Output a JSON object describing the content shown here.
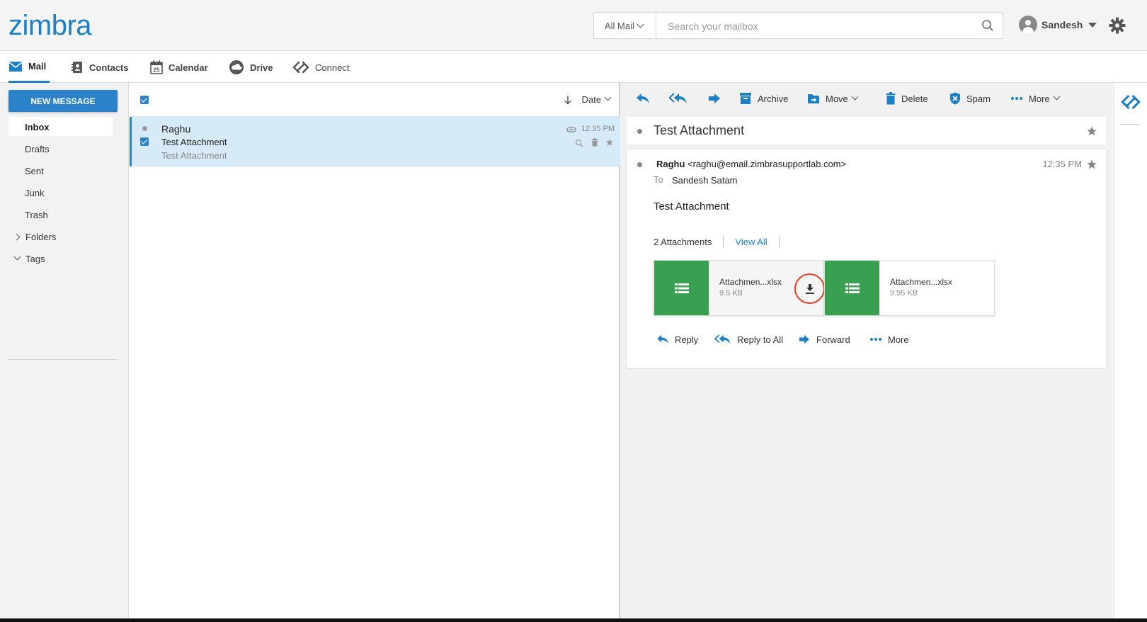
{
  "app": {
    "logo": "zimbra"
  },
  "search": {
    "scope": "All Mail",
    "placeholder": "Search your mailbox"
  },
  "user": {
    "name": "Sandesh"
  },
  "nav": {
    "tabs": [
      "Mail",
      "Contacts",
      "Calendar",
      "Drive",
      "Connect"
    ],
    "calendar_day": "25",
    "active": "Mail"
  },
  "sidebar": {
    "new_message": "NEW MESSAGE",
    "folders": [
      "Inbox",
      "Drafts",
      "Sent",
      "Junk",
      "Trash"
    ],
    "collapsible": [
      "Folders",
      "Tags"
    ]
  },
  "list": {
    "sort_label": "Date",
    "messages": [
      {
        "from": "Raghu",
        "subject": "Test Attachment",
        "preview": "Test Attachment",
        "time": "12:35 PM",
        "selected": true,
        "has_attachment": true
      }
    ]
  },
  "reader": {
    "toolbar": {
      "archive": "Archive",
      "move": "Move",
      "delete": "Delete",
      "spam": "Spam",
      "more": "More"
    },
    "subject": "Test Attachment",
    "message": {
      "sender_name": "Raghu",
      "sender_email": "<raghu@email.zimbrasupportlab.com>",
      "time": "12:35 PM",
      "to_label": "To",
      "to": "Sandesh Satam",
      "body": "Test Attachment",
      "attachments_count": "2 Attachments",
      "view_all": "View All",
      "attachments": [
        {
          "name": "Attachmen...xlsx",
          "size": "9.5 KB"
        },
        {
          "name": "Attachmen...xlsx",
          "size": "9.95 KB"
        }
      ],
      "actions": {
        "reply": "Reply",
        "reply_all": "Reply to All",
        "forward": "Forward",
        "more": "More"
      }
    }
  },
  "colors": {
    "accent": "#1d7fc4",
    "new_message_bg": "#2b82c9",
    "selected_row": "#d6eaf7",
    "attachment_icon": "#3aa051",
    "download_highlight": "#e4412c"
  }
}
